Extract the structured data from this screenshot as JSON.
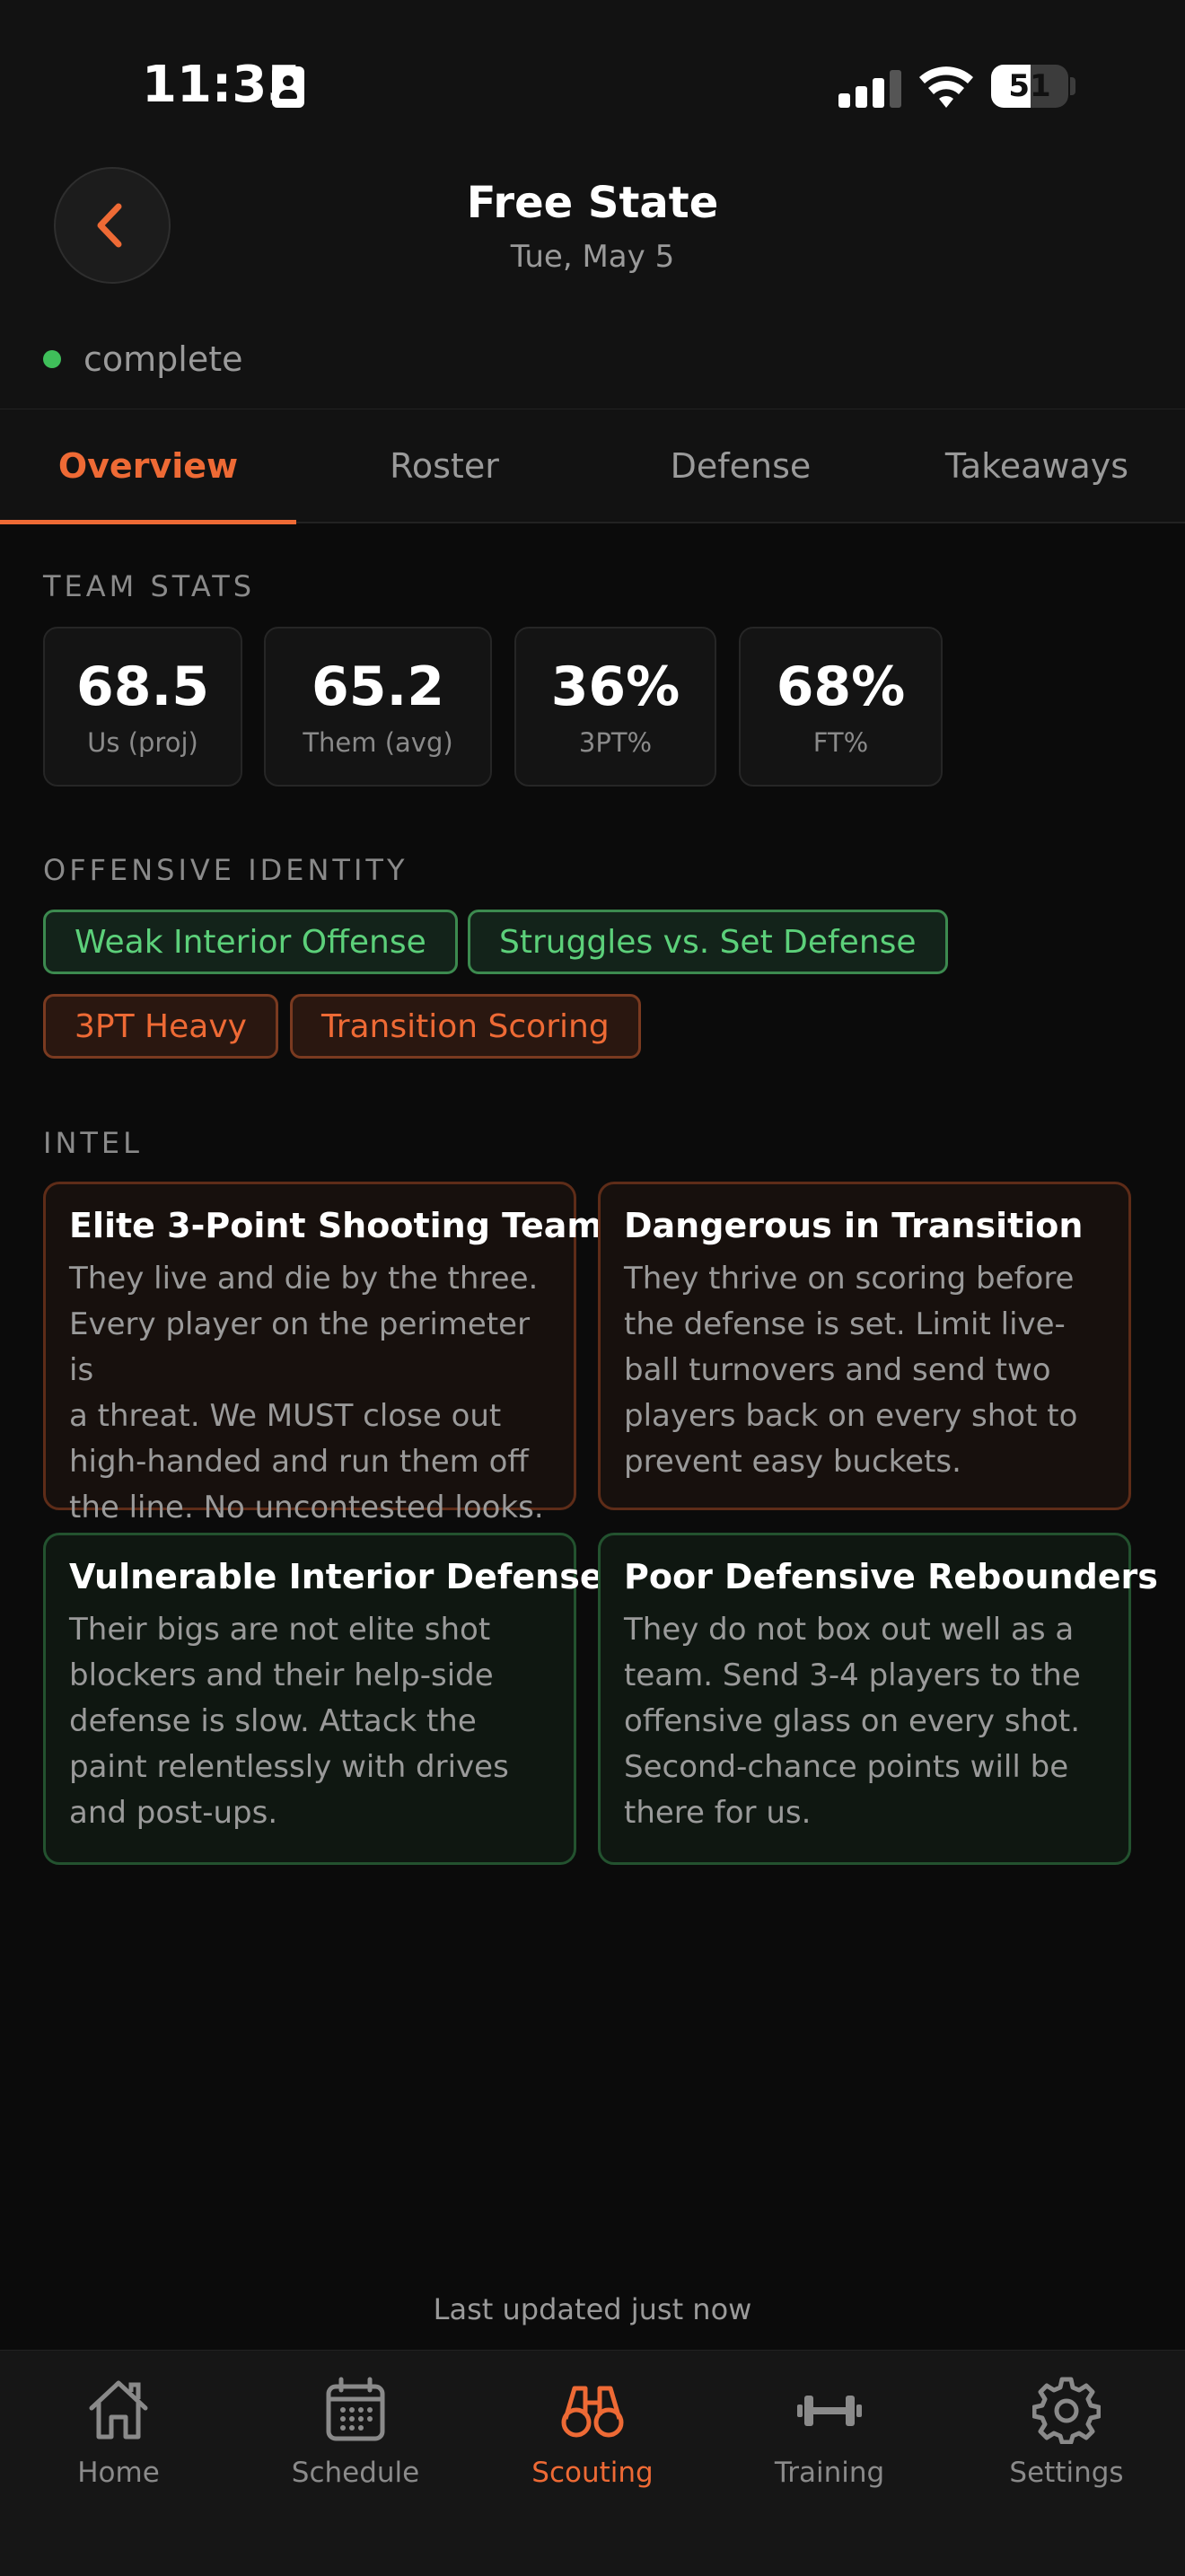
{
  "status_bar": {
    "time": "11:35",
    "battery": "51",
    "battery_level": 0.51
  },
  "header": {
    "title": "Free State",
    "subtitle": "Tue, May 5",
    "status": "complete",
    "status_color": "#3fbf5a"
  },
  "tabs": [
    {
      "label": "Overview",
      "active": true
    },
    {
      "label": "Roster",
      "active": false
    },
    {
      "label": "Defense",
      "active": false
    },
    {
      "label": "Takeaways",
      "active": false
    }
  ],
  "team_stats": {
    "label": "TEAM STATS",
    "stats": [
      {
        "value": "68.5",
        "label": "Us (proj)"
      },
      {
        "value": "65.2",
        "label": "Them (avg)"
      },
      {
        "value": "36%",
        "label": "3PT%"
      },
      {
        "value": "68%",
        "label": "FT%"
      }
    ]
  },
  "offensive_identity": {
    "label": "OFFENSIVE IDENTITY",
    "tags": [
      {
        "text": "Weak Interior Offense",
        "tone": "green"
      },
      {
        "text": "Struggles vs. Set Defense",
        "tone": "green"
      },
      {
        "text": "3PT Heavy",
        "tone": "orange"
      },
      {
        "text": "Transition Scoring",
        "tone": "orange"
      }
    ]
  },
  "intel": {
    "label": "INTEL",
    "cards": [
      {
        "title": "Elite 3-Point Shooting Team",
        "lines": [
          "They live and die by the three.",
          "Every player on the perimeter is",
          "a threat. We MUST close out",
          "high-handed and run them off",
          "the line. No uncontested looks."
        ],
        "tone": "orange"
      },
      {
        "title": "Dangerous in Transition",
        "lines": [
          "They thrive on scoring before",
          "the defense is set. Limit live-",
          "ball turnovers and send two",
          "players back on every shot to",
          "prevent easy buckets."
        ],
        "tone": "orange"
      },
      {
        "title": "Vulnerable Interior Defense",
        "lines": [
          "Their bigs are not elite shot",
          "blockers and their help-side",
          "defense is slow. Attack the",
          "paint relentlessly with drives",
          "and post-ups."
        ],
        "tone": "green"
      },
      {
        "title": "Poor Defensive Rebounders",
        "lines": [
          "They do not box out well as a",
          "team. Send 3-4 players to the",
          "offensive glass on every shot.",
          "Second-chance points will be",
          "there for us."
        ],
        "tone": "green"
      }
    ]
  },
  "footer": {
    "updated": "Last updated just now"
  },
  "nav": [
    {
      "label": "Home",
      "icon": "home-icon",
      "active": false
    },
    {
      "label": "Schedule",
      "icon": "calendar-icon",
      "active": false
    },
    {
      "label": "Scouting",
      "icon": "binoculars-icon",
      "active": true
    },
    {
      "label": "Training",
      "icon": "dumbbell-icon",
      "active": false
    },
    {
      "label": "Settings",
      "icon": "gear-icon",
      "active": false
    }
  ],
  "colors": {
    "accent": "#ee6a35",
    "positive": "#5cd07a",
    "background": "#0b0b0b"
  }
}
